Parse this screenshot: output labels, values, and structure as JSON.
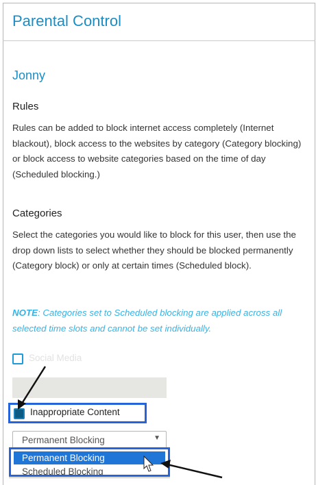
{
  "page": {
    "title": "Parental Control",
    "user_name": "Jonny"
  },
  "rules": {
    "heading": "Rules",
    "description": "Rules can be added to block internet access completely (Internet blackout), block access to the websites by category (Category blocking) or block access to website categories based on the time of day (Scheduled blocking.)"
  },
  "categories": {
    "heading": "Categories",
    "description": "Select the categories you would like to block for this user, then use the drop down lists to select whether they should be blocked permanently (Category block) or only at certain times (Scheduled block).",
    "note_label": "NOTE",
    "note_text": ": Categories set to Scheduled blocking are applied across all selected time slots and cannot be set individually.",
    "items": [
      {
        "label": "Social Media",
        "checked": false
      },
      {
        "label": "Inappropriate Content",
        "checked": true
      }
    ]
  },
  "blocking_select": {
    "value": "Permanent Blocking",
    "arrow_icon": "chevron-down-icon",
    "options": [
      "Permanent Blocking",
      "Scheduled Blocking"
    ],
    "highlighted_index": 0
  },
  "colors": {
    "accent": "#1b8dc4",
    "highlight_box": "#2463d9",
    "option_highlight": "#2076d6",
    "note": "#35b3e6"
  }
}
